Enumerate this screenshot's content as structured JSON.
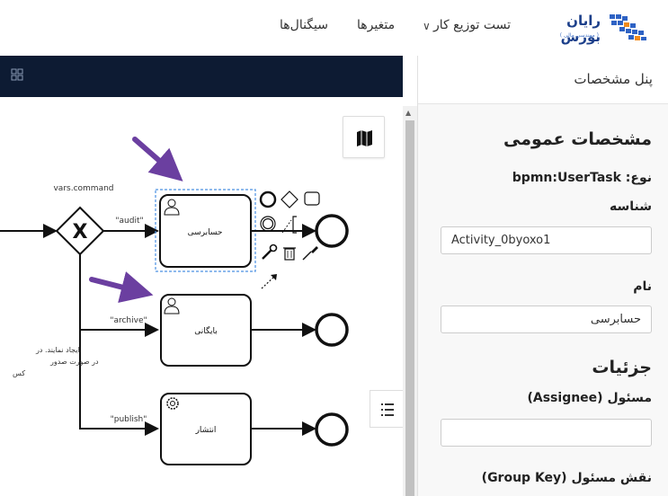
{
  "header": {
    "logo_name": "رایان بورس",
    "logo_tagline": "( مهندسی مالی )",
    "nav_items": [
      {
        "label": "تست توزیع کار",
        "has_dropdown": true
      },
      {
        "label": "متغیرها"
      },
      {
        "label": "سیگنال‌ها"
      }
    ]
  },
  "diagram": {
    "gateway_label": "vars.command",
    "flows": [
      "\"audit\"",
      "\"archive\"",
      "\"publish\""
    ],
    "tasks": [
      {
        "name": "حسابرسی",
        "kind": "user-task",
        "selected": true
      },
      {
        "name": "بایگانی",
        "kind": "user-task"
      },
      {
        "name": "انتشار",
        "kind": "service-task"
      }
    ],
    "annotation_lines": [
      "ایجاد نمایند. در",
      "در صورت صدور",
      "کس"
    ]
  },
  "panel": {
    "title": "پنل مشخصات",
    "general_section": "مشخصات عمومی",
    "type_label": "نوع:",
    "type_value": "bpmn:UserTask",
    "id_label": "شناسه",
    "id_value": "Activity_0byoxo1",
    "name_label": "نام",
    "name_value": "حسابرسی",
    "details_section": "جزئیات",
    "assignee_label": "مسئول (Assignee)",
    "assignee_value": "",
    "group_label": "نقش مسئول (Group Key)"
  },
  "colors": {
    "canvas_bar": "#0d1b33",
    "selection": "#4a90e2",
    "arrow": "#6b3fa0",
    "logo": "#1c3f8a"
  }
}
